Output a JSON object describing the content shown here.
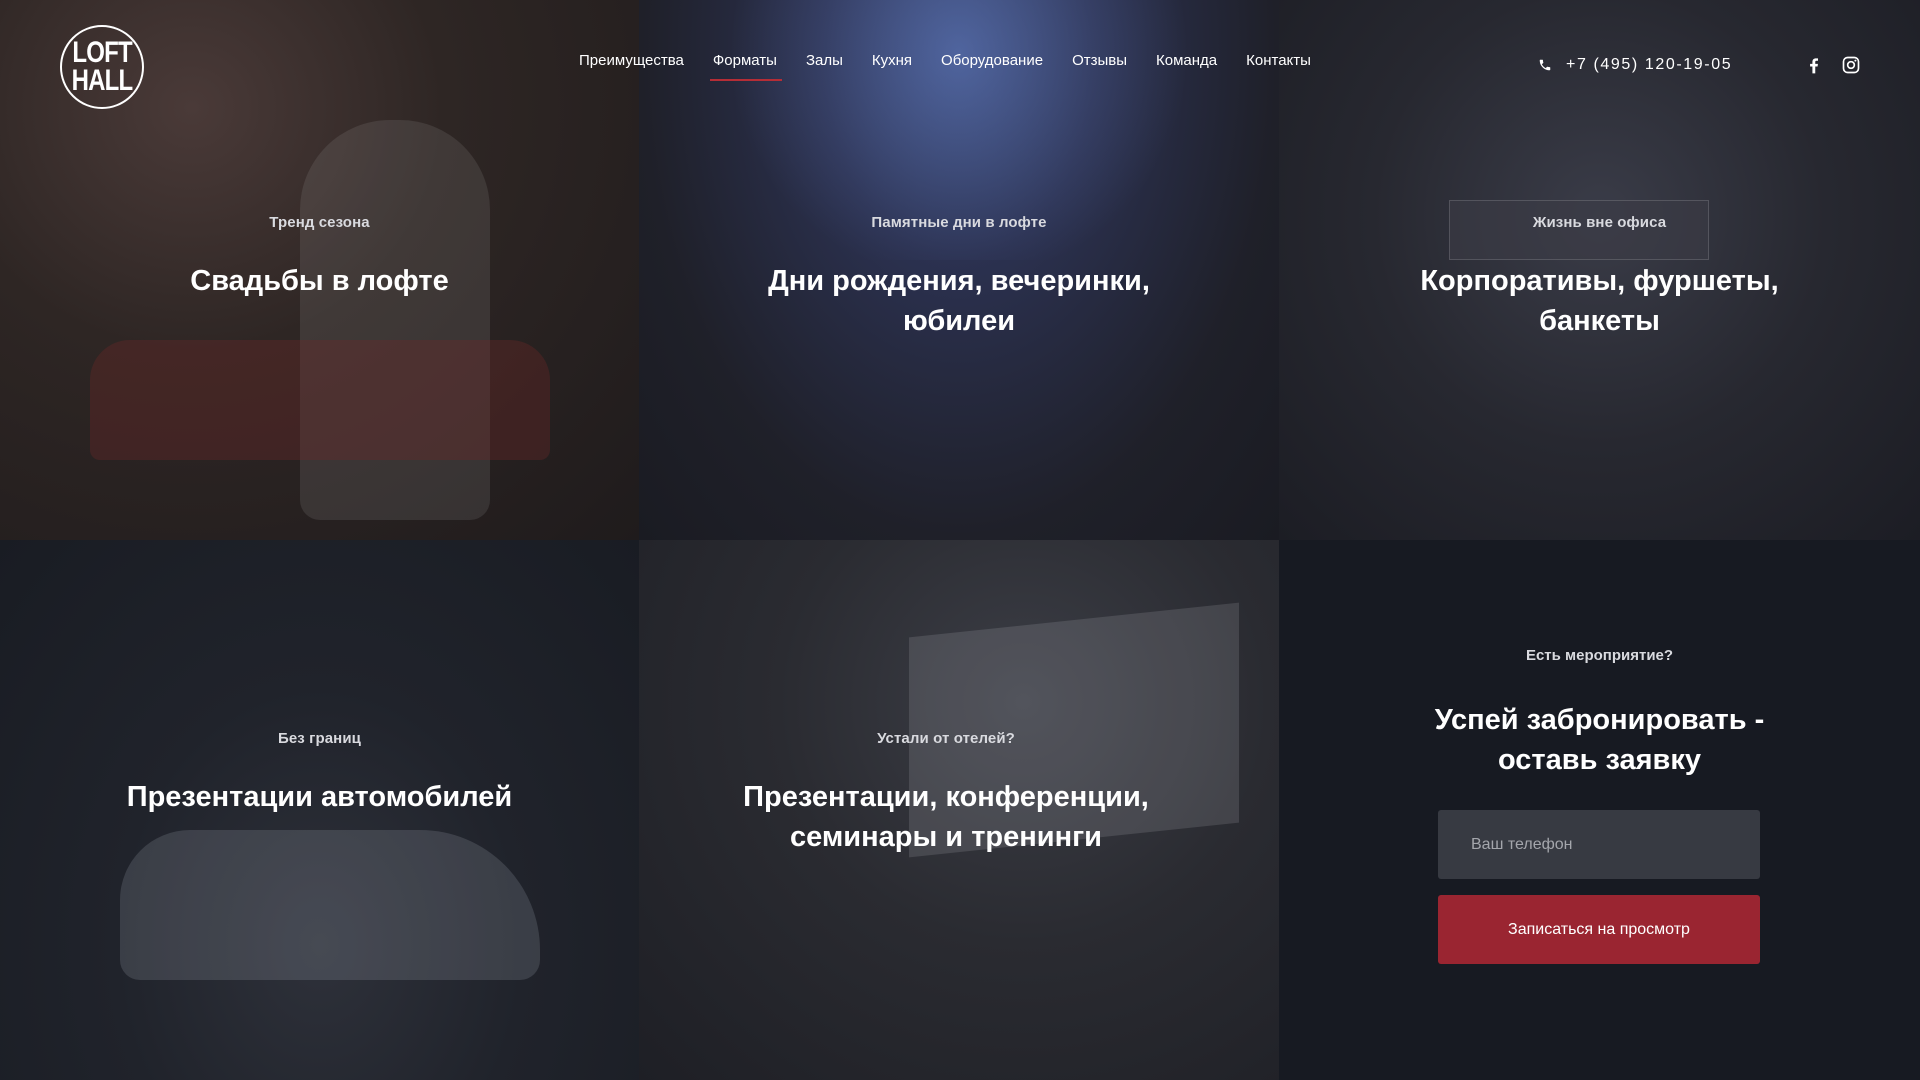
{
  "brand": {
    "logo_line1": "LOFT",
    "logo_line2": "HALL"
  },
  "nav": {
    "items": [
      {
        "label": "Преимущества"
      },
      {
        "label": "Форматы",
        "active": true
      },
      {
        "label": "Залы"
      },
      {
        "label": "Кухня"
      },
      {
        "label": "Оборудование"
      },
      {
        "label": "Отзывы"
      },
      {
        "label": "Команда"
      },
      {
        "label": "Контакты"
      }
    ]
  },
  "contact": {
    "phone": "+7 (495) 120-19-05",
    "phone_icon": "phone-icon"
  },
  "social": {
    "facebook_icon": "facebook-icon",
    "instagram_icon": "instagram-icon"
  },
  "formats": [
    {
      "subtitle": "Тренд сезона",
      "title_line1": "Свадьбы в лофте",
      "title_line2": ""
    },
    {
      "subtitle": "Памятные дни в лофте",
      "title_line1": "Дни рождения, вечеринки,",
      "title_line2": "юбилеи"
    },
    {
      "subtitle": "Жизнь вне офиса",
      "title_line1": "Корпоративы, фуршеты,",
      "title_line2": "банкеты"
    },
    {
      "subtitle": "Без границ",
      "title_line1": "Презентации автомобилей",
      "title_line2": ""
    },
    {
      "subtitle": "Устали от отелей?",
      "title_line1": "Презентации, конференции,",
      "title_line2": "семинары и тренинги"
    }
  ],
  "booking": {
    "subtitle": "Есть мероприятие?",
    "title_line1": "Успей забронировать -",
    "title_line2": "оставь заявку",
    "phone_placeholder": "Ваш телефон",
    "button_label": "Записаться на просмотр"
  },
  "colors": {
    "accent": "#b52d36",
    "button": "#9a2531",
    "background": "#171a22",
    "input": "#373a42"
  }
}
